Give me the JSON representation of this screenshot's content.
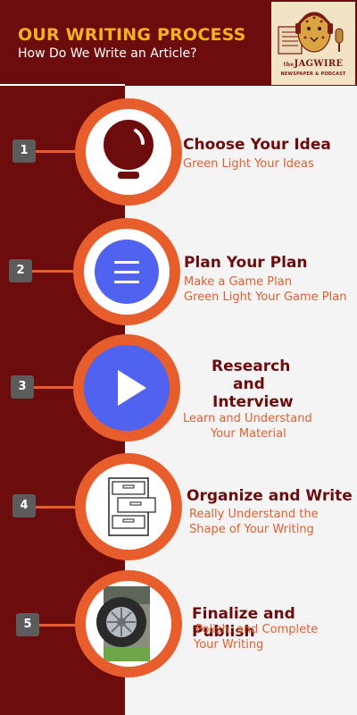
{
  "header": {
    "title": "OUR WRITING PROCESS",
    "subtitle": "How Do We Write an Article?"
  },
  "logo": {
    "name": "JAGWIRE",
    "name_prefix": "the",
    "tagline": "NEWSPAPER & PODCAST"
  },
  "colors": {
    "maroon": "#6d0c0c",
    "orange": "#e85d2c",
    "gold": "#f5b21b",
    "blue": "#4f63f0"
  },
  "steps": [
    {
      "number": "1",
      "title": "Choose Your Idea",
      "lines": [
        "Green Light Your Ideas"
      ],
      "icon": "lightbulb-icon"
    },
    {
      "number": "2",
      "title": "Plan Your Plan",
      "lines": [
        "Make a Game Plan",
        "Green Light Your Game Plan"
      ],
      "icon": "menu-icon"
    },
    {
      "number": "3",
      "title_lines": [
        "Research",
        "and",
        "Interview"
      ],
      "lines": [
        "Learn and Understand",
        "Your Material"
      ],
      "icon": "play-icon"
    },
    {
      "number": "4",
      "title": "Organize and Write",
      "lines": [
        "Really Understand the",
        "Shape of Your Writing"
      ],
      "icon": "file-cabinet-icon"
    },
    {
      "number": "5",
      "title": "Finalize and Publish",
      "lines": [
        " Polish, and Complete",
        "Your Writing"
      ],
      "icon": "tire-photo"
    }
  ]
}
